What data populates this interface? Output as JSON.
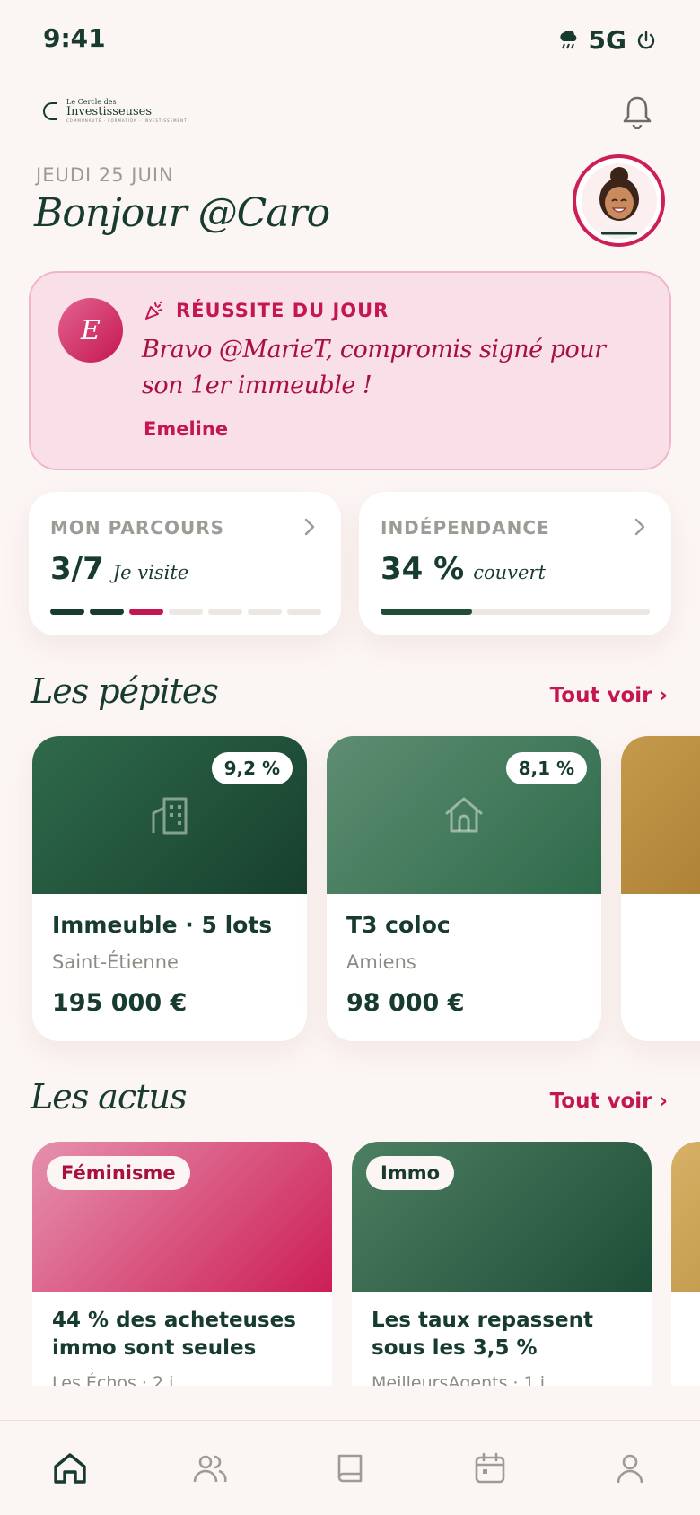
{
  "status_bar": {
    "time": "9:41",
    "network": "5G"
  },
  "header": {
    "brand_line1": "Le Cercle des",
    "brand_line2": "Investisseuses",
    "brand_tagline": "COMMUNAUTÉ · FORMATION · INVESTISSEMENT",
    "date": "JEUDI 25 JUIN",
    "greeting": "Bonjour @Caro"
  },
  "success": {
    "badge_letter": "E",
    "label": "RÉUSSITE DU JOUR",
    "message": "Bravo @MarieT, compromis signé pour son 1er immeuble !",
    "author": "Emeline"
  },
  "stats": {
    "parcours": {
      "title": "MON PARCOURS",
      "value": "3/7",
      "sub": "Je visite",
      "total_steps": 7,
      "completed_steps": 2,
      "current_step": 3
    },
    "independance": {
      "title": "INDÉPENDANCE",
      "value": "34 %",
      "sub": "couvert",
      "progress": 0.34
    }
  },
  "pepites": {
    "title": "Les pépites",
    "see_all": "Tout voir ›",
    "items": [
      {
        "yield": "9,2 %",
        "name": "Immeuble · 5 lots",
        "city": "Saint-Étienne",
        "price": "195 000 €",
        "icon": "building-icon"
      },
      {
        "yield": "8,1 %",
        "name": "T3 coloc",
        "city": "Amiens",
        "price": "98 000 €",
        "icon": "house-icon"
      }
    ]
  },
  "actus": {
    "title": "Les actus",
    "see_all": "Tout voir ›",
    "items": [
      {
        "tag": "Féminisme",
        "title": "44 % des acheteuses immo sont seules",
        "meta": "Les Échos · 2 j"
      },
      {
        "tag": "Immo",
        "title": "Les taux repassent sous les 3,5 %",
        "meta": "MeilleursAgents · 1 j"
      }
    ]
  },
  "tabbar": [
    "home-icon",
    "community-icon",
    "book-icon",
    "calendar-icon",
    "profile-icon"
  ],
  "colors": {
    "accent": "#C4174F",
    "primary": "#173B2C",
    "background": "#FBF5F3"
  }
}
